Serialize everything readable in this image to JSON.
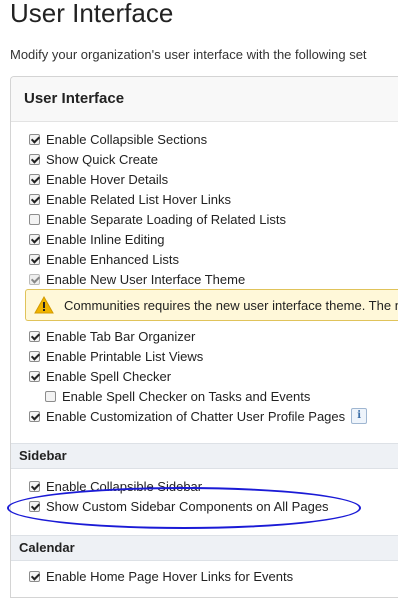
{
  "page": {
    "title": "User Interface",
    "description": "Modify your organization's user interface with the following set"
  },
  "panel": {
    "title": "User Interface"
  },
  "settings": [
    {
      "label": "Enable Collapsible Sections",
      "checked": true
    },
    {
      "label": "Show Quick Create",
      "checked": true
    },
    {
      "label": "Enable Hover Details",
      "checked": true
    },
    {
      "label": "Enable Related List Hover Links",
      "checked": true
    },
    {
      "label": "Enable Separate Loading of Related Lists",
      "checked": false
    },
    {
      "label": "Enable Inline Editing",
      "checked": true
    },
    {
      "label": "Enable Enhanced Lists",
      "checked": true
    },
    {
      "label": "Enable New User Interface Theme",
      "checked": true,
      "disabled": true
    }
  ],
  "warning": {
    "text": "Communities requires the new user interface theme. The n",
    "icon": "warning-triangle-icon"
  },
  "settings2": [
    {
      "label": "Enable Tab Bar Organizer",
      "checked": true
    },
    {
      "label": "Enable Printable List Views",
      "checked": true
    },
    {
      "label": "Enable Spell Checker",
      "checked": true
    },
    {
      "label": "Enable Spell Checker on Tasks and Events",
      "checked": false
    },
    {
      "label": "Enable Customization of Chatter User Profile Pages",
      "checked": true
    }
  ],
  "sidebar": {
    "title": "Sidebar",
    "items": [
      {
        "label": "Enable Collapsible Sidebar",
        "checked": true
      },
      {
        "label": "Show Custom Sidebar Components on All Pages",
        "checked": true
      }
    ]
  },
  "calendar": {
    "title": "Calendar",
    "items": [
      {
        "label": "Enable Home Page Hover Links for Events",
        "checked": true
      }
    ]
  },
  "colors": {
    "highlight": "#1a1ad6",
    "warning_bg": "#fff8d9",
    "warning_icon": "#f0b400"
  }
}
